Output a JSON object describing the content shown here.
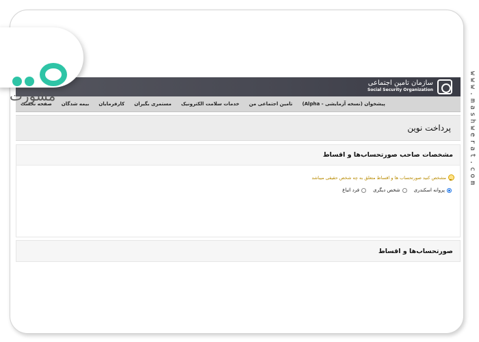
{
  "branding": {
    "logo_text": "مشورت",
    "watermark": "www.mashwerat.com"
  },
  "header": {
    "org_name_fa": "سازمان تامین اجتماعی",
    "org_name_en": "Social Security Organization"
  },
  "nav": {
    "items": [
      "صفحه نخست",
      "بیمه شدگان",
      "کارفرمایان",
      "مستمری بگیران",
      "خدمات سلامت الکترونیک",
      "تامین اجتماعی من",
      "پیشخوان (نسخه آزمایشی - Alpha)"
    ]
  },
  "page": {
    "title": "پرداخت نوین"
  },
  "section_owner": {
    "title": "مشخصات صاحب صورتحساب‌ها و اقساط",
    "hint": "مشخص کنید صورتحساب ها و اقساط متعلق به چه شخص حقیقی میباشد",
    "options": [
      {
        "label": "پروانه اسکندری",
        "checked": true
      },
      {
        "label": "شخص دیگری",
        "checked": false
      },
      {
        "label": "فرد اتباع",
        "checked": false
      }
    ]
  },
  "section_bills": {
    "title": "صورتحساب‌ها و اقساط"
  },
  "colors": {
    "header_bg": "#474852",
    "nav_bg": "#d6d6d6",
    "accent_teal": "#2ec4a6",
    "hint_color": "#b88a00",
    "radio_selected": "#1a73e8"
  }
}
